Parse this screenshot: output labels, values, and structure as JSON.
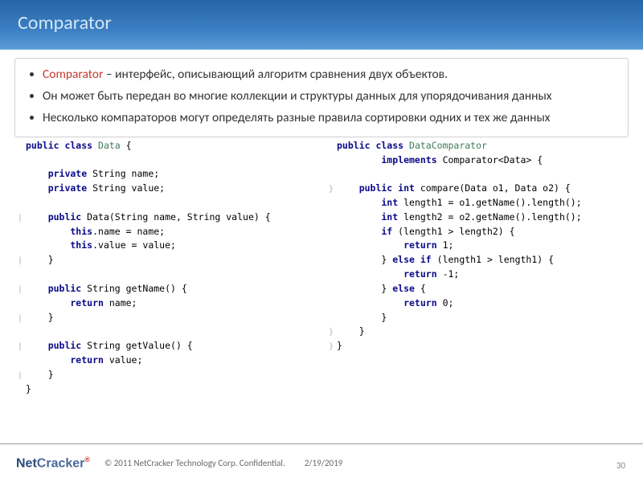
{
  "header": {
    "title": "Comparator"
  },
  "bullets": {
    "b1_keyword": "Comparator",
    "b1_rest": " – интерфейс, описывающий алгоритм сравнения двух объектов.",
    "b2": "Он может быть передан во многие  коллекции и структуры данных для упорядочивания данных",
    "b3": "Несколько компараторов могут определять разные правила сортировки одних и тех же данных"
  },
  "code_left": {
    "l01a": "public class ",
    "l01b": "Data",
    "l01c": " {",
    "l02": "",
    "l03a": "    private ",
    "l03b": "String name;",
    "l04a": "    private ",
    "l04b": "String value;",
    "l05": "",
    "l06a": "    public ",
    "l06b": "Data(String name, String value) {",
    "l07a": "        this",
    "l07b": ".name = name;",
    "l08a": "        this",
    "l08b": ".value = value;",
    "l09": "    }",
    "l10": "",
    "l11a": "    public ",
    "l11b": "String getName() {",
    "l12a": "        return ",
    "l12b": "name;",
    "l13": "    }",
    "l14": "",
    "l15a": "    public ",
    "l15b": "String getValue() {",
    "l16a": "        return ",
    "l16b": "value;",
    "l17": "    }",
    "l18": "}"
  },
  "code_right": {
    "r01a": "public class ",
    "r01b": "DataComparator",
    "r02a": "        implements ",
    "r02b": "Comparator<Data> {",
    "r03": "",
    "r04a": "    public int ",
    "r04b": "compare(Data o1, Data o2) {",
    "r05a": "        int ",
    "r05b": "length1 = o1.getName().length();",
    "r06a": "        int ",
    "r06b": "length2 = o2.getName().length();",
    "r07a": "        if ",
    "r07b": "(length1 > length2) {",
    "r08a": "            return ",
    "r08b": "1;",
    "r09a": "        } ",
    "r09b": "else if ",
    "r09c": "(length1 > length1) {",
    "r10a": "            return ",
    "r10b": "-1;",
    "r11a": "        } ",
    "r11b": "else ",
    "r11c": "{",
    "r12a": "            return ",
    "r12b": "0;",
    "r13": "        }",
    "r14": "    }",
    "r15": "}"
  },
  "footer": {
    "logo_a": "Net",
    "logo_b": "Cracker",
    "logo_sup": "®",
    "copyright": "© 2011 NetCracker Technology Corp. Confidential.",
    "date": "2/19/2019",
    "page": "30"
  }
}
